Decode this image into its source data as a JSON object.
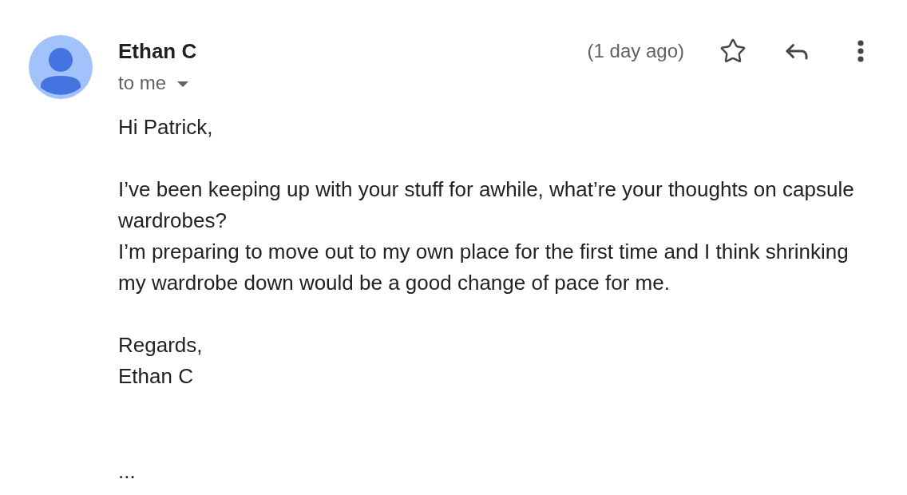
{
  "message": {
    "sender": "Ethan C",
    "recipient": "to me",
    "time": "(1 day ago)",
    "starred": false
  },
  "body": {
    "paragraphs": [
      [
        "Hi Patrick,"
      ],
      [
        "I’ve been keeping up with your stuff for awhile, what’re your thoughts on capsule wardrobes?",
        "I’m preparing to move out to my own place for the first time and I think shrinking my wardrobe down would be a good change of pace for me."
      ],
      [
        "Regards,",
        "Ethan C"
      ]
    ]
  },
  "trimmed_content": "..."
}
